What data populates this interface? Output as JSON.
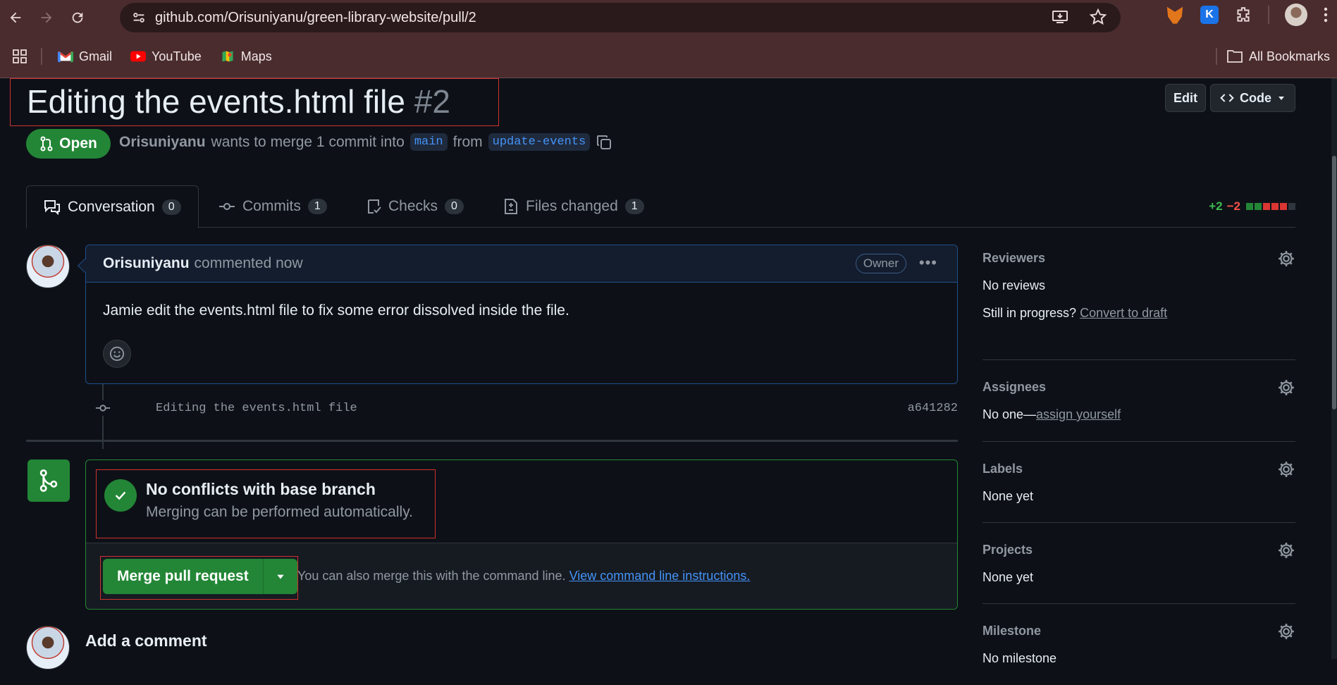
{
  "browser": {
    "url": "github.com/Orisuniyanu/green-library-website/pull/2",
    "bookmarks": [
      {
        "label": "Gmail",
        "icon": "gmail-icon",
        "color": "#ea4335"
      },
      {
        "label": "YouTube",
        "icon": "youtube-icon",
        "color": "#ff0000"
      },
      {
        "label": "Maps",
        "icon": "maps-icon",
        "color": "#34a853"
      }
    ],
    "all_bookmarks": "All Bookmarks"
  },
  "pr": {
    "title": "Editing the events.html file",
    "number": "#2",
    "state": "Open",
    "author": "Orisuniyanu",
    "merge_text": "wants to merge 1 commit into",
    "base_branch": "main",
    "from_text": "from",
    "head_branch": "update-events",
    "edit_label": "Edit",
    "code_label": "Code"
  },
  "tabs": [
    {
      "label": "Conversation",
      "count": "0"
    },
    {
      "label": "Commits",
      "count": "1"
    },
    {
      "label": "Checks",
      "count": "0"
    },
    {
      "label": "Files changed",
      "count": "1"
    }
  ],
  "diffstat": {
    "additions": "+2",
    "deletions": "−2",
    "colors": [
      "#238636",
      "#238636",
      "#da3633",
      "#da3633",
      "#da3633",
      "#30363d"
    ]
  },
  "comment": {
    "author": "Orisuniyanu",
    "action": "commented now",
    "role": "Owner",
    "body": "Jamie edit the events.html file to fix some error dissolved inside the file."
  },
  "commit": {
    "message": "Editing the events.html file",
    "sha": "a641282"
  },
  "merge": {
    "title": "No conflicts with base branch",
    "subtitle": "Merging can be performed automatically.",
    "button": "Merge pull request",
    "note": "You can also merge this with the command line.",
    "note_link": "View command line instructions."
  },
  "add_comment": "Add a comment",
  "sidebar": {
    "reviewers": {
      "title": "Reviewers",
      "value": "No reviews",
      "progress_q": "Still in progress?",
      "progress_link": "Convert to draft"
    },
    "assignees": {
      "title": "Assignees",
      "value": "No one—",
      "link": "assign yourself"
    },
    "labels": {
      "title": "Labels",
      "value": "None yet"
    },
    "projects": {
      "title": "Projects",
      "value": "None yet"
    },
    "milestone": {
      "title": "Milestone",
      "value": "No milestone"
    }
  }
}
